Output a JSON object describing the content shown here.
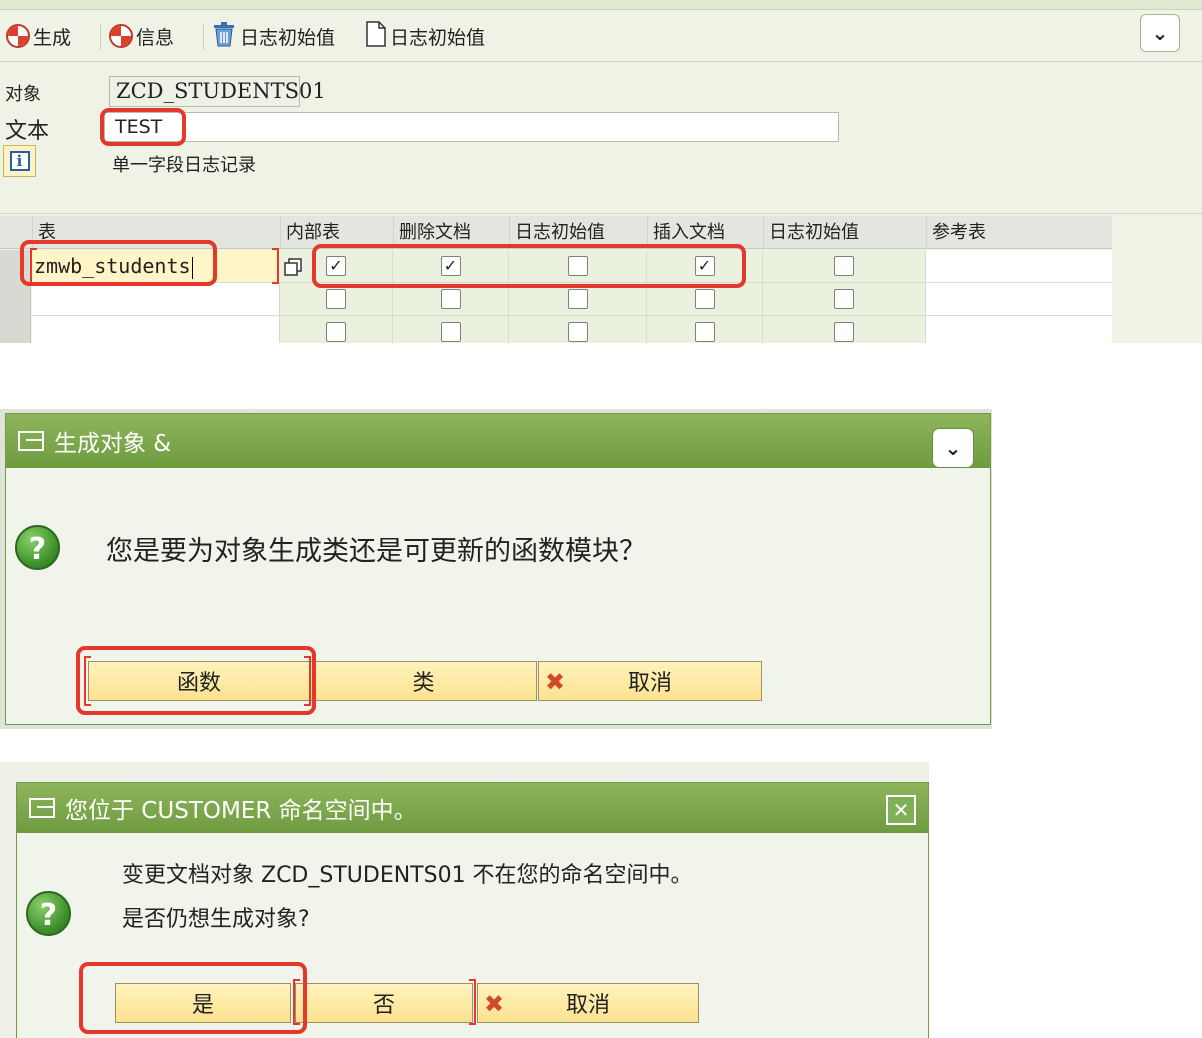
{
  "panel1": {
    "toolbar": [
      {
        "label": "生成",
        "icon": "sap-generate-icon"
      },
      {
        "label": "信息",
        "icon": "sap-info-icon"
      },
      {
        "label": "日志初始值",
        "icon": "trash-icon"
      },
      {
        "label": "日志初始值",
        "icon": "document-icon"
      }
    ],
    "menu_icon": "⌄",
    "object_label": "对象",
    "object_value": "ZCD_STUDENTS01",
    "text_label": "文本",
    "text_value": "TEST",
    "info_icon_glyph": "i",
    "info_description": "单一字段日志记录",
    "table": {
      "headers": [
        "表",
        "内部表",
        "删除文档",
        "日志初始值",
        "插入文档",
        "日志初始值",
        "参考表"
      ],
      "rows": [
        {
          "table": "zmwb_students",
          "checks": [
            true,
            true,
            false,
            true,
            false
          ],
          "ref": ""
        },
        {
          "table": "",
          "checks": [
            false,
            false,
            false,
            false,
            false
          ],
          "ref": ""
        },
        {
          "table": "",
          "checks": [
            false,
            false,
            false,
            false,
            false
          ],
          "ref": ""
        }
      ]
    }
  },
  "panel2": {
    "title": "生成对象 &",
    "menu_icon": "⌄",
    "question_glyph": "?",
    "message": "您是要为对象生成类还是可更新的函数模块？",
    "buttons": {
      "function": "函数",
      "class": "类",
      "cancel": "取消"
    },
    "cancel_glyph": "✖"
  },
  "panel3": {
    "title": "您位于 CUSTOMER 命名空间中。",
    "close_glyph": "✕",
    "question_glyph": "?",
    "line1": "变更文档对象 ZCD_STUDENTS01 不在您的命名空间中。",
    "line2": "是否仍想生成对象?",
    "buttons": {
      "yes": "是",
      "no": "否",
      "cancel": "取消"
    },
    "cancel_glyph": "✖"
  },
  "colors": {
    "highlight": "#e3382b",
    "title_bar": "#7aa548",
    "button": "#fbe28f"
  }
}
